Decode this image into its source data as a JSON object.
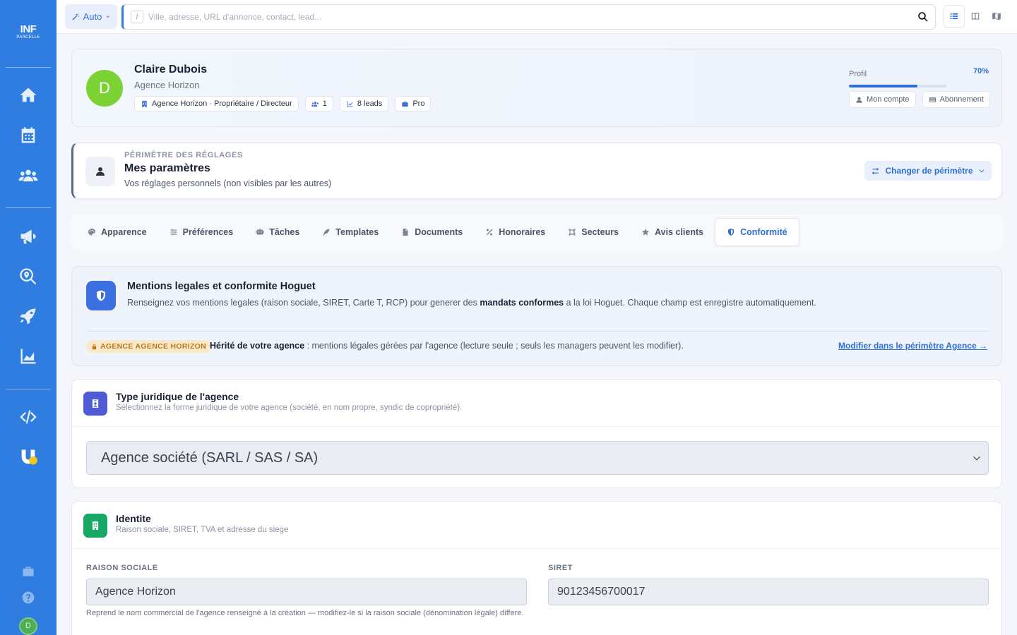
{
  "app": {
    "logo_top": "INF",
    "logo_bottom": "PARCELLE"
  },
  "topbar": {
    "mode_label": "Auto",
    "search_shortcut": "/",
    "search_placeholder": "Ville, adresse, URL d'annonce, contact, lead..."
  },
  "profile": {
    "initial": "D",
    "name": "Claire Dubois",
    "agency": "Agence Horizon",
    "badges": {
      "role": "Agence Horizon · Propriétaire / Directeur",
      "members": "1",
      "leads": "8 leads",
      "plan": "Pro"
    },
    "progress_label": "Profil",
    "progress_percent_label": "70%",
    "progress_value": 70,
    "account_btn": "Mon compte",
    "subscription_btn": "Abonnement"
  },
  "scope": {
    "kicker": "PÉRIMÈTRE DES RÉGLAGES",
    "title": "Mes paramètres",
    "description": "Vos réglages personnels (non visibles par les autres)",
    "change_btn": "Changer de périmètre"
  },
  "tabs": [
    {
      "label": "Apparence",
      "icon": "palette-icon"
    },
    {
      "label": "Préférences",
      "icon": "sliders-icon"
    },
    {
      "label": "Tâches",
      "icon": "robot-icon"
    },
    {
      "label": "Templates",
      "icon": "feather-icon"
    },
    {
      "label": "Documents",
      "icon": "file-icon"
    },
    {
      "label": "Honoraires",
      "icon": "percent-icon"
    },
    {
      "label": "Secteurs",
      "icon": "draw-polygon-icon"
    },
    {
      "label": "Avis clients",
      "icon": "star-icon"
    },
    {
      "label": "Conformité",
      "icon": "shield-icon",
      "active": true
    }
  ],
  "legal": {
    "title": "Mentions legales et conformite Hoguet",
    "desc_pre": "Renseignez vos mentions legales (raison sociale, SIRET, Carte T, RCP) pour generer des ",
    "desc_bold": "mandats conformes",
    "desc_post": " a la loi Hoguet. Chaque champ est enregistre automatiquement.",
    "tag": "AGENCE AGENCE HORIZON",
    "inherit_bold": "Hérité de votre agence",
    "inherit_text": " : mentions légales gérées par l'agence (lecture seule ; seuls les managers peuvent les modifier).",
    "modify_link": "Modifier dans le périmètre Agence →"
  },
  "type_section": {
    "title": "Type juridique de l'agence",
    "subtitle": "Sélectionnez la forme juridique de votre agence (société, en nom propre, syndic de copropriété).",
    "selected": "Agence société (SARL / SAS / SA)"
  },
  "identity_section": {
    "title": "Identite",
    "subtitle": "Raison sociale, SIRET, TVA et adresse du siege",
    "raison_label": "RAISON SOCIALE",
    "raison_value": "Agence Horizon",
    "raison_help": "Reprend le nom commercial de l'agence renseigné à la création — modifiez-le si la raison sociale (dénomination légale) differe.",
    "siret_label": "SIRET",
    "siret_value": "90123456700017"
  },
  "colors": {
    "brand": "#2f7de1",
    "accent": "#2f6fd6",
    "avatar": "#7dd233",
    "legal_icon": "#3c6fe0",
    "type_icon": "#4f5bd5",
    "identity_icon": "#17a865"
  }
}
